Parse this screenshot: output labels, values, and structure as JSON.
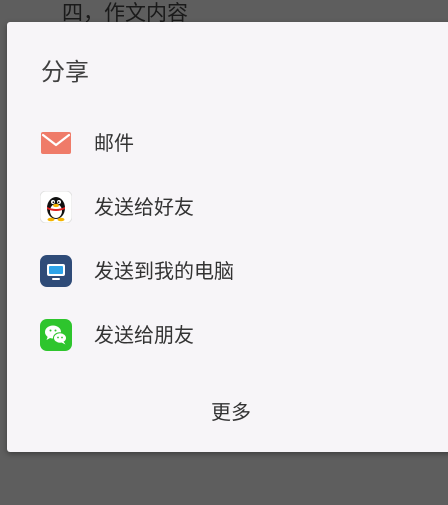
{
  "background": {
    "heading": "四，作文内容"
  },
  "dialog": {
    "title": "分享",
    "items": [
      {
        "label": "邮件",
        "icon": "mail-icon",
        "color": "#ef7b69"
      },
      {
        "label": "发送给好友",
        "icon": "qq-penguin-icon",
        "color": "#000000"
      },
      {
        "label": "发送到我的电脑",
        "icon": "computer-icon",
        "color": "#2f4b78"
      },
      {
        "label": "发送给朋友",
        "icon": "wechat-icon",
        "color": "#2ec52d"
      }
    ],
    "more_label": "更多"
  },
  "colors": {
    "scrim": "#5e5e5e",
    "sheet": "#f7f5f8",
    "text": "#333333"
  }
}
